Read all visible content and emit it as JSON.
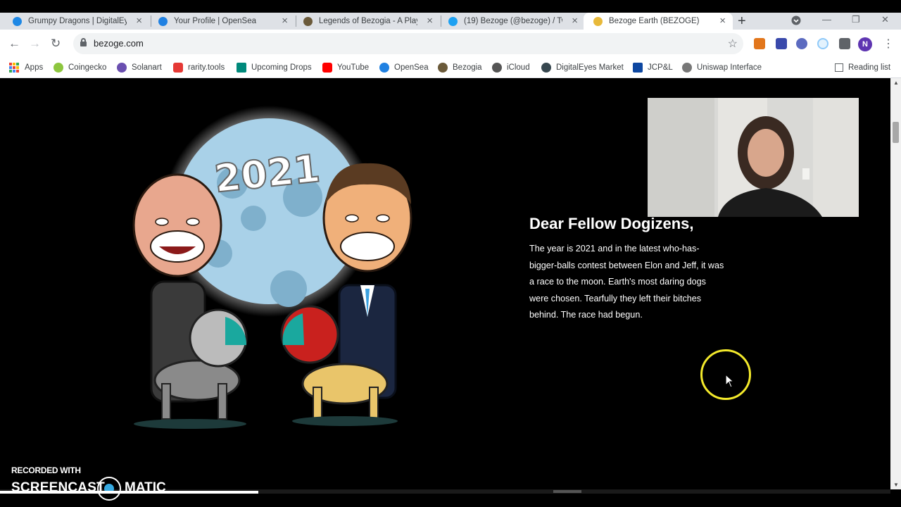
{
  "browser": {
    "tabs": [
      {
        "title": "Grumpy Dragons | DigitalEyes",
        "favicon": "digitaleyes-icon",
        "color": "#1e88e5",
        "active": false
      },
      {
        "title": "Your Profile | OpenSea",
        "favicon": "opensea-icon",
        "color": "#2081e2",
        "active": false
      },
      {
        "title": "Legends of Bezogia - A Play",
        "favicon": "bezogia-icon",
        "color": "#6b5a3a",
        "active": false
      },
      {
        "title": "(19) Bezoge (@bezoge) / Twi",
        "favicon": "twitter-icon",
        "color": "#1da1f2",
        "active": false
      },
      {
        "title": "Bezoge Earth (BEZOGE)",
        "favicon": "coin-icon",
        "color": "#e8b93a",
        "active": true
      }
    ],
    "url": "bezoge.com",
    "profile_initial": "N",
    "bookmarks": [
      {
        "label": "Apps",
        "icon": "apps-grid-icon",
        "color": "#4285f4"
      },
      {
        "label": "Coingecko",
        "icon": "coingecko-icon",
        "color": "#8dc63f"
      },
      {
        "label": "Solanart",
        "icon": "solanart-icon",
        "color": "#6a4fb0"
      },
      {
        "label": "rarity.tools",
        "icon": "rarity-tools-icon",
        "color": "#e53935"
      },
      {
        "label": "Upcoming Drops",
        "icon": "upcoming-drops-icon",
        "color": "#00897b"
      },
      {
        "label": "YouTube",
        "icon": "youtube-icon",
        "color": "#ff0000"
      },
      {
        "label": "OpenSea",
        "icon": "opensea-icon",
        "color": "#2081e2"
      },
      {
        "label": "Bezogia",
        "icon": "bezogia-icon",
        "color": "#6b5a3a"
      },
      {
        "label": "iCloud",
        "icon": "apple-icon",
        "color": "#555555"
      },
      {
        "label": "DigitalEyes Market",
        "icon": "digitaleyes-icon",
        "color": "#37474f"
      },
      {
        "label": "JCP&L",
        "icon": "jcpl-icon",
        "color": "#0d47a1"
      },
      {
        "label": "Uniswap Interface",
        "icon": "uniswap-icon",
        "color": "#555555"
      }
    ],
    "reading_list": "Reading list"
  },
  "page": {
    "heading": "Dear Fellow Dogizens,",
    "body": "The year is 2021 and in the latest who-has-bigger-balls contest between Elon and Jeff, it was a race to the moon. Earth's most daring dogs were chosen. Tearfully they left their bitches behind. The race had begun.",
    "art_year": "2021"
  },
  "overlay": {
    "recorded_with": "RECORDED WITH",
    "brand_left": "SCREENCAST",
    "brand_right": "MATIC",
    "cursor_highlight_color": "#f3e92b"
  }
}
